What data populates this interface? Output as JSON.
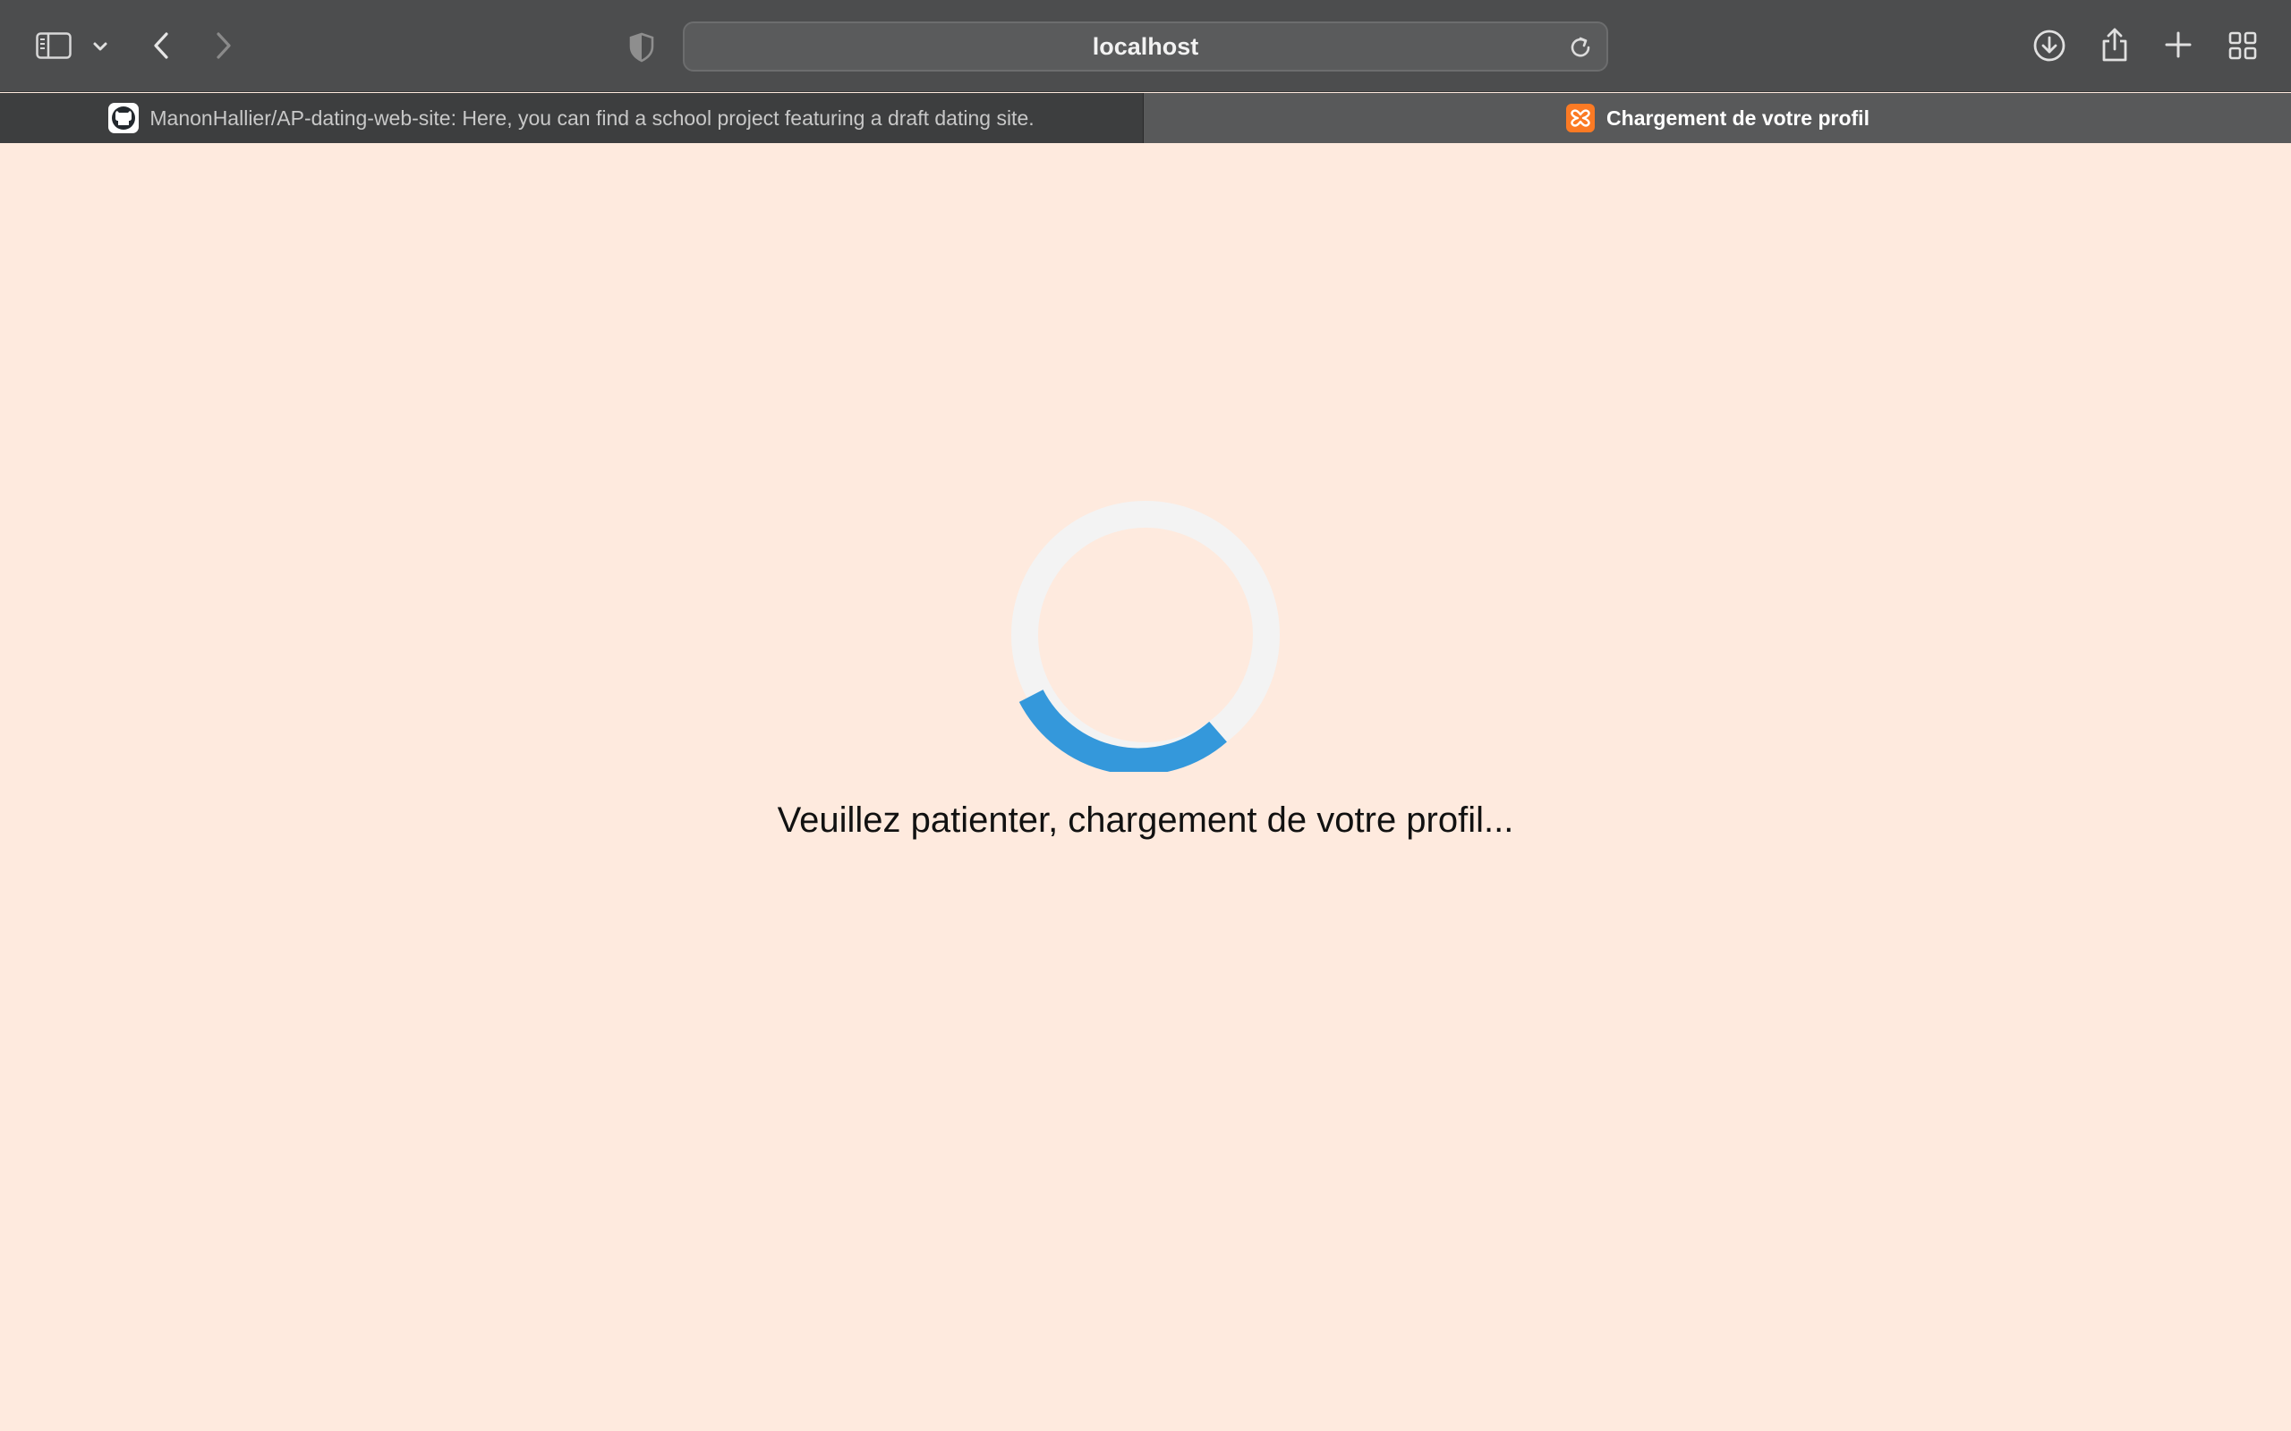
{
  "browser": {
    "address": "localhost",
    "tabs": [
      {
        "title": "ManonHallier/AP-dating-web-site: Here, you can find a school project featuring a draft dating site.",
        "favicon": "github-icon",
        "active": false
      },
      {
        "title": "Chargement de votre profil",
        "favicon": "xampp-icon",
        "active": true
      }
    ],
    "toolbar_icons": [
      "sidebar-icon",
      "chevron-down-icon",
      "back-icon",
      "forward-icon",
      "shield-icon",
      "reload-icon",
      "download-icon",
      "share-icon",
      "new-tab-icon",
      "tab-overview-icon"
    ]
  },
  "page": {
    "loading_text": "Veuillez patienter, chargement de votre profil...",
    "spinner": {
      "track_color": "#f3f3f3",
      "arc_color": "#3498db"
    }
  },
  "colors": {
    "page_background": "#feeade",
    "toolbar": "#4c4d4e",
    "active_tab": "#58595a",
    "inactive_tab": "#3d3e3f"
  }
}
